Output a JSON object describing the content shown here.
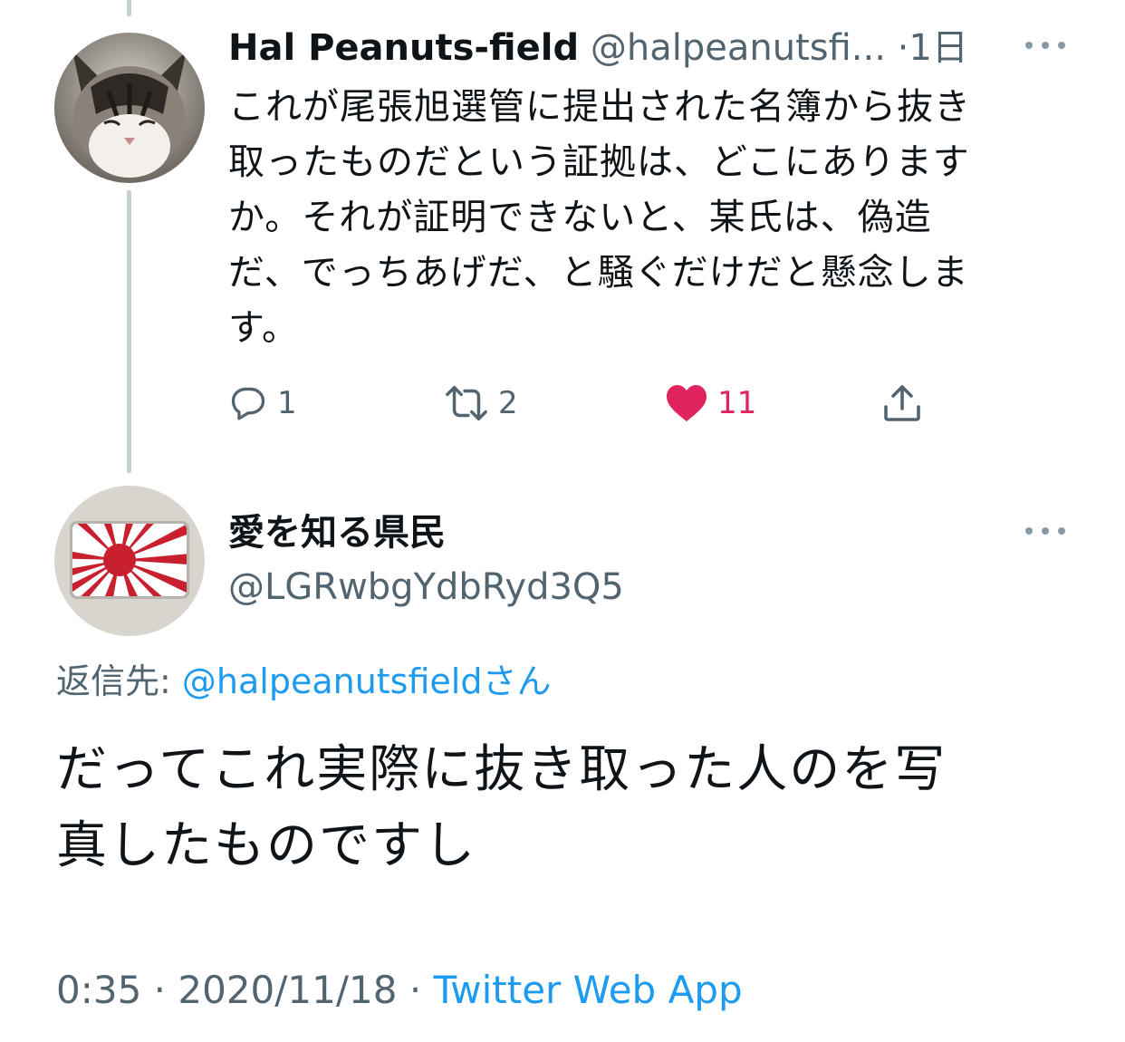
{
  "colors": {
    "accent": "#1d9bf0",
    "like": "#e0245e",
    "muted": "#536471",
    "text": "#0f1419"
  },
  "tweet1": {
    "avatar_icon": "cat-avatar",
    "name": "Hal Peanuts-field",
    "handle": "@halpeanutsfi...",
    "separator": "·",
    "time": "1日",
    "text": "これが尾張旭選管に提出された名簿から抜き\n取ったものだという証拠は、どこにあります\nか。それが証明できないと、某氏は、偽造\nだ、でっちあげだ、と騒ぐだけだと懸念しま\nす。",
    "actions": {
      "reply_count": "1",
      "retweet_count": "2",
      "like_count": "11"
    }
  },
  "tweet2": {
    "avatar_icon": "rising-sun-flag-avatar",
    "name": "愛を知る県民",
    "handle": "@LGRwbgYdbRyd3Q5",
    "reply_prefix": "返信先: ",
    "reply_handle": "@halpeanutsfieldさん",
    "text": "だってこれ実際に抜き取った人のを写\n真したものですし",
    "time": "0:35",
    "sep1": " · ",
    "date": "2020/11/18",
    "sep2": " · ",
    "source": "Twitter Web App"
  }
}
